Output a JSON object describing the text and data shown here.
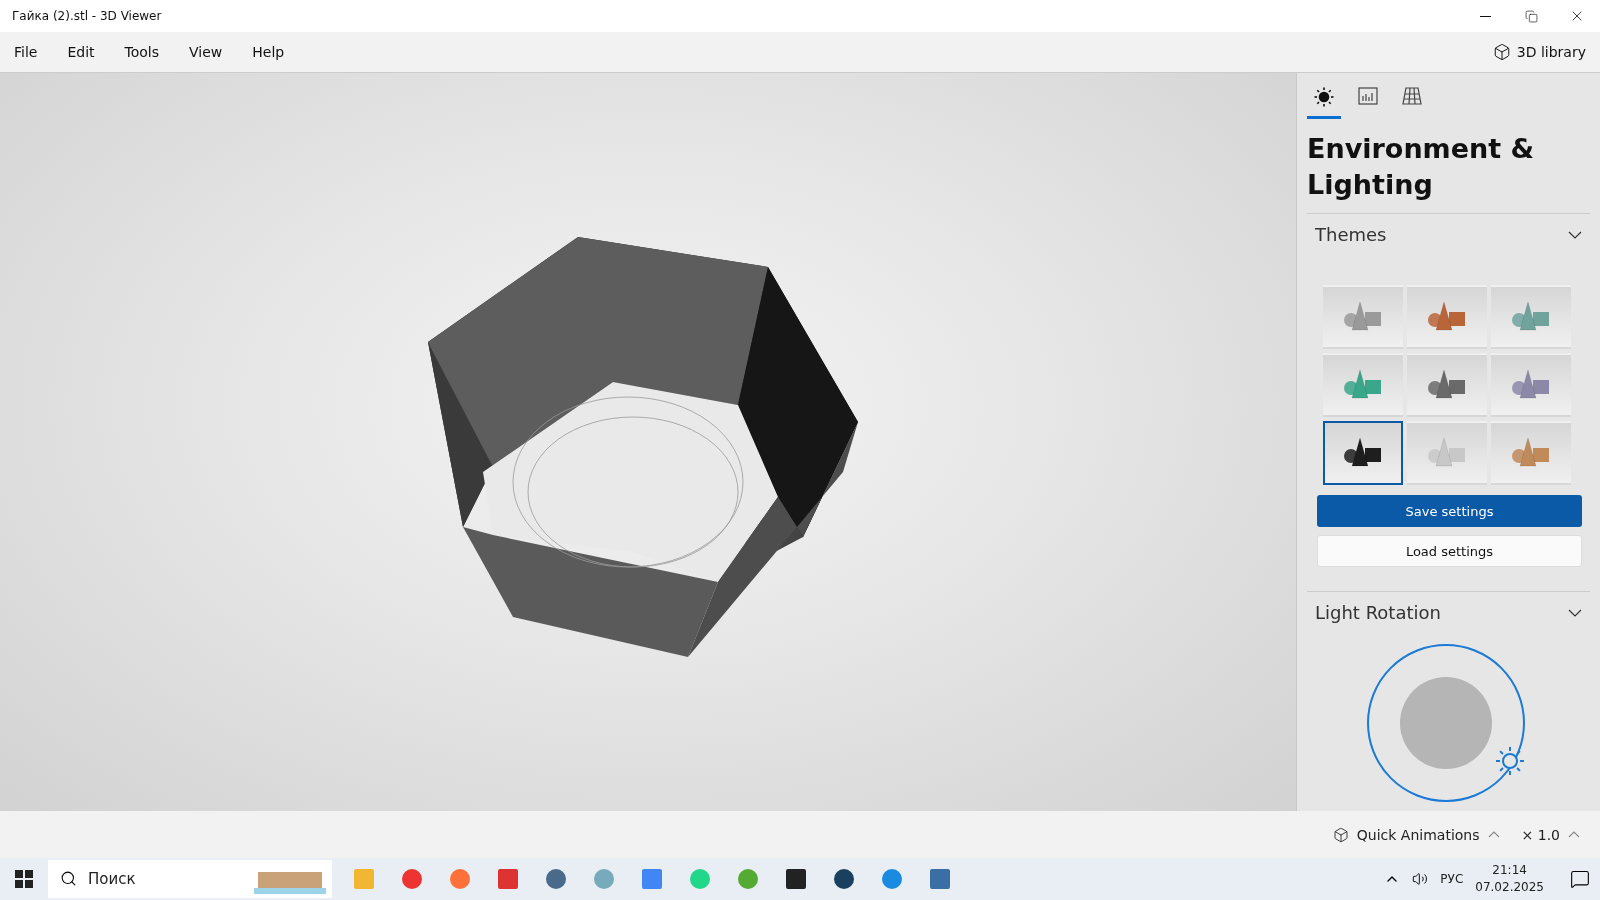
{
  "window": {
    "title": "Гайка (2).stl - 3D Viewer"
  },
  "menu": [
    "File",
    "Edit",
    "Tools",
    "View",
    "Help"
  ],
  "library_button": "3D library",
  "panel": {
    "tabs": [
      {
        "selected": true
      },
      {
        "selected": false
      },
      {
        "selected": false
      }
    ],
    "heading": "Environment & Lighting",
    "themes": {
      "title": "Themes",
      "expanded": true,
      "items": [
        {
          "color": "#9a9a9a",
          "selected": false
        },
        {
          "color": "#b8653a",
          "selected": false
        },
        {
          "color": "#6fa39c",
          "selected": false
        },
        {
          "color": "#3aa68a",
          "selected": false
        },
        {
          "color": "#6a6a6a",
          "selected": false
        },
        {
          "color": "#8c88a8",
          "selected": false
        },
        {
          "color": "#1e1e1e",
          "selected": true
        },
        {
          "color": "#c8c8c8",
          "selected": false
        },
        {
          "color": "#c08a5a",
          "selected": false
        }
      ]
    },
    "save_button": "Save settings",
    "load_button": "Load settings",
    "light_rotation": {
      "title": "Light Rotation",
      "expanded": true
    }
  },
  "bottom_bar": {
    "animations": "Quick Animations",
    "speed": "× 1.0"
  },
  "taskbar": {
    "search_placeholder": "Поиск",
    "language": "РУС",
    "time": "21:14",
    "date": "07.02.2025"
  }
}
